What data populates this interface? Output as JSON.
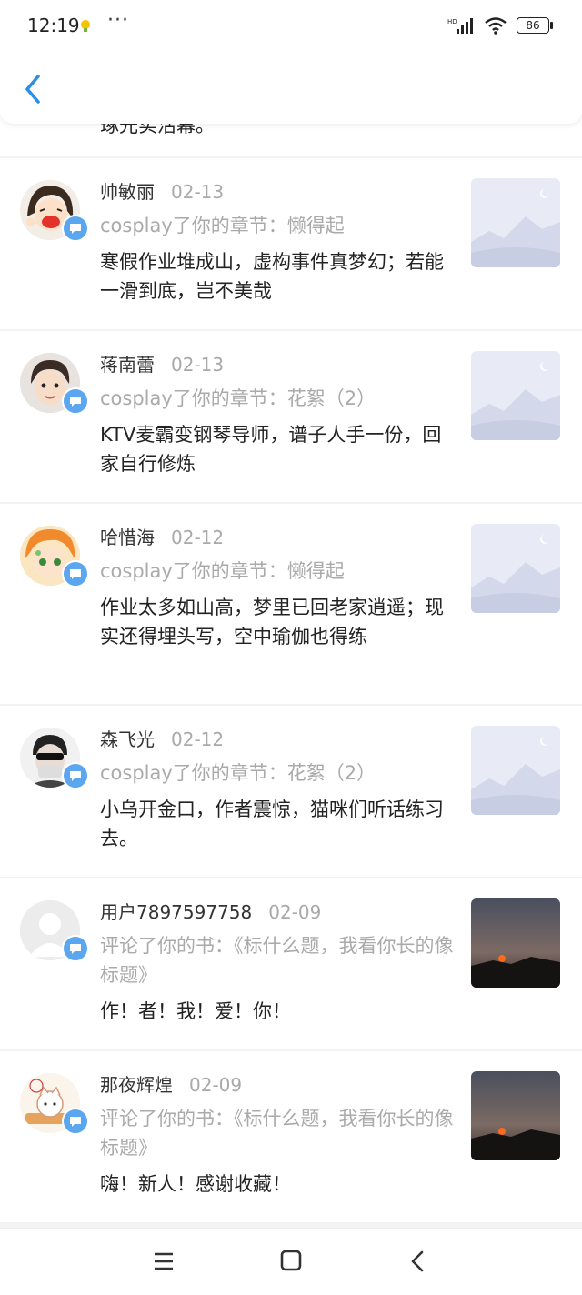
{
  "status": {
    "time": "12:19",
    "dots": "···",
    "battery": "86"
  },
  "partial": {
    "text": "琢光实活幕。"
  },
  "notifications": [
    {
      "name": "帅敏丽",
      "date": "02-13",
      "action": "cosplay了你的章节：懒得起",
      "comment": "寒假作业堆成山，虚构事件真梦幻；若能一滑到底，岂不美哉",
      "avatar": "cartoon-girl",
      "thumb": "placeholder"
    },
    {
      "name": "蒋南蕾",
      "date": "02-13",
      "action": "cosplay了你的章节：花絮（2）",
      "comment": "KTV麦霸变钢琴导师，谱子人手一份，回家自行修炼",
      "avatar": "child-photo",
      "thumb": "placeholder"
    },
    {
      "name": "哈惜海",
      "date": "02-12",
      "action": "cosplay了你的章节：懒得起",
      "comment": "作业太多如山高，梦里已回老家逍遥；现实还得埋头写，空中瑜伽也得练",
      "avatar": "anime-boy",
      "thumb": "placeholder"
    },
    {
      "name": "森飞光",
      "date": "02-12",
      "action": "cosplay了你的章节：花絮（2）",
      "comment": "小乌开金口，作者震惊，猫咪们听话练习去。",
      "avatar": "masked-person",
      "thumb": "placeholder"
    },
    {
      "name": "用户7897597758",
      "date": "02-09",
      "action": "评论了你的书：《标什么题，我看你长的像标题》",
      "comment": "作！者！我！爱！你！",
      "avatar": "default-user",
      "thumb": "sunset"
    },
    {
      "name": "那夜辉煌",
      "date": "02-09",
      "action": "评论了你的书：《标什么题，我看你长的像标题》",
      "comment": "嗨！新人！感谢收藏！",
      "avatar": "cartoon-cat",
      "thumb": "sunset"
    }
  ],
  "nav": {
    "menu": "menu-icon",
    "home": "home-icon",
    "back": "back-icon"
  }
}
